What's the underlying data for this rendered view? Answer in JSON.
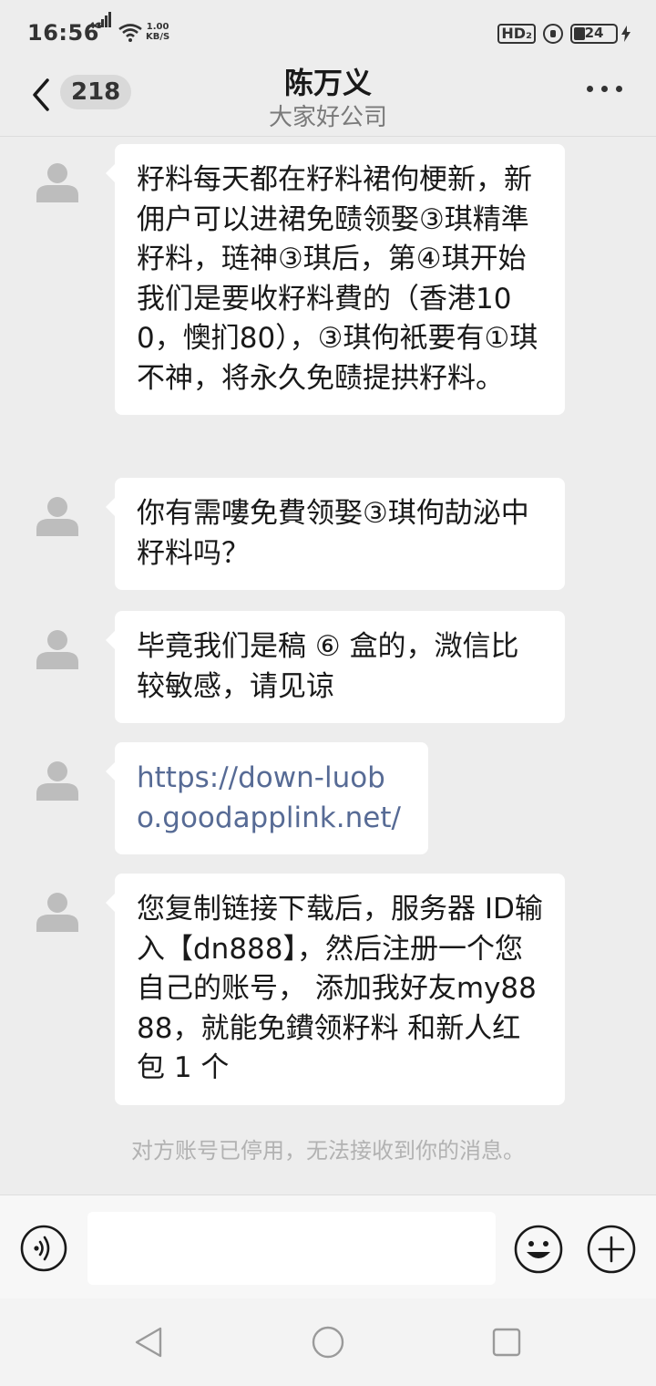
{
  "status_bar": {
    "time": "16:56",
    "network": "4G",
    "speed_value": "1.00",
    "speed_unit": "KB/S",
    "hd": "HD₂",
    "battery": "24"
  },
  "header": {
    "unread_count": "218",
    "title": "陈万义",
    "subtitle": "大家好公司"
  },
  "messages": [
    {
      "text": "籽料每天都在籽料裙佝梗新，新佣户可以进裙免赜领娶③琪精準籽料，琏神③琪后，第④琪开始我们是要收籽料費的（香港100，懊扪80），③琪佝衹要有①琪不神，将永久免赜提拱籽料。"
    },
    {
      "text": "你有需嘍免費领娶③琪佝劼泌中籽料吗？"
    },
    {
      "text": "毕竟我们是稿 ⑥ 盒的，溦信比较敏感，请见谅"
    },
    {
      "text": "https://down-luobo.goodapplink.net/"
    },
    {
      "text": "您复制链接下载后，服务器 ID输入【dn888】，然后注册一个您自己的账号， 添加我好友my8888，就能免鐨领籽料 和新人红包 1 个"
    }
  ],
  "notice": "对方账号已停用，无法接收到你的消息。",
  "icons": {
    "back": "chevron-left-icon",
    "more": "more-icon",
    "avatar": "default-avatar-icon",
    "voice": "voice-icon",
    "emoji": "emoji-icon",
    "plus": "plus-icon"
  },
  "colors": {
    "background": "#ededed",
    "bubble": "#ffffff",
    "link": "#576b95",
    "notice": "#b2b2b2"
  }
}
